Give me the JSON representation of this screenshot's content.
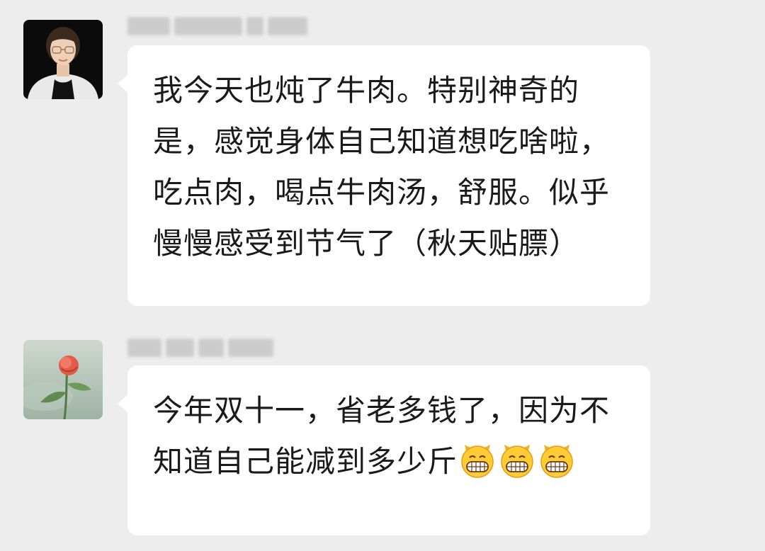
{
  "messages": [
    {
      "sender": "",
      "text": "我今天也炖了牛肉。特别神奇的是，感觉身体自己知道想吃啥啦，吃点肉，喝点牛肉汤，舒服。似乎慢慢感受到节气了（秋天贴膘）",
      "avatar": "woman-portrait-avatar",
      "emojis": []
    },
    {
      "sender": "",
      "text": "今年双十一，省老多钱了，因为不知道自己能减到多少斤",
      "avatar": "rose-flower-avatar",
      "emojis": [
        "grin-emoji",
        "grin-emoji",
        "grin-emoji"
      ]
    }
  ],
  "colors": {
    "background": "#ededed",
    "bubble": "#ffffff",
    "text": "#1a1a1a"
  }
}
